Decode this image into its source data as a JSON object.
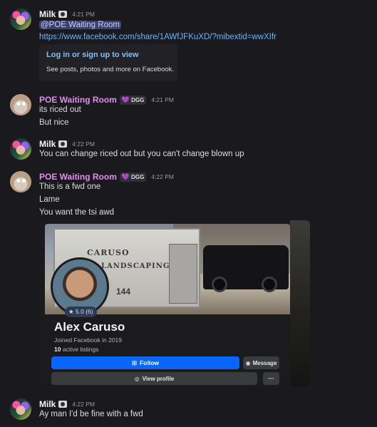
{
  "messages": [
    {
      "author": "Milk",
      "time": "4:21 PM",
      "mention": "@POE Waiting Room",
      "link": "https://www.facebook.com/share/1AWfJFKuXD/?mibextid=wwXIfr",
      "embed": {
        "title": "Log in or sign up to view",
        "description": "See posts, photos and more on Facebook."
      }
    },
    {
      "author": "POE Waiting Room",
      "tag": "DGG",
      "time": "4:21 PM",
      "lines": [
        "its riced out",
        "But nice"
      ]
    },
    {
      "author": "Milk",
      "time": "4:22 PM",
      "lines": [
        "You can change riced out but you can't change blown up"
      ]
    },
    {
      "author": "POE Waiting Room",
      "tag": "DGG",
      "time": "4:22 PM",
      "lines": [
        "This is a fwd one",
        "Lame",
        "You want the tsi awd"
      ]
    },
    {
      "author": "Milk",
      "time": "4:22 PM",
      "lines": [
        "Ay man I'd be fine with a fwd"
      ]
    }
  ],
  "profile_card": {
    "cover_text_1": "CARUSO",
    "cover_text_2": "LANDSCAPING",
    "cover_number": "144",
    "rating": "5.0 (6)",
    "name": "Alex Caruso",
    "joined": "Joined Facebook in 2019",
    "listings_count": "10",
    "listings_label": "active listings",
    "follow_label": "Follow",
    "message_label": "Message",
    "view_profile_label": "View profile",
    "more_label": "···"
  },
  "colors": {
    "background": "#1a1a1e",
    "poe_name": "#e38cf0",
    "link": "#6ab4ff",
    "follow": "#0866ff"
  }
}
